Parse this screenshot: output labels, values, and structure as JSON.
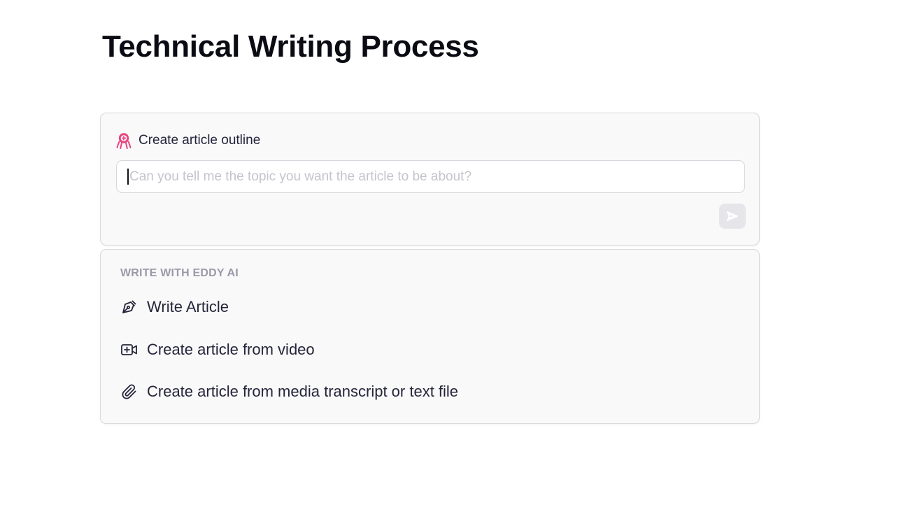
{
  "page": {
    "title": "Technical Writing Process"
  },
  "prompt": {
    "header_label": "Create article outline",
    "mascot_icon": "octopus-mascot-icon",
    "input_placeholder": "Can you tell me the topic you want the article to be about?",
    "input_value": "",
    "send_icon": "send-icon",
    "accent_color": "#e8457f"
  },
  "actions": {
    "heading": "WRITE WITH EDDY AI",
    "items": [
      {
        "label": "Write Article",
        "icon": "pen-nib-icon"
      },
      {
        "label": "Create article from video",
        "icon": "video-plus-icon"
      },
      {
        "label": "Create article from media transcript or text file",
        "icon": "paperclip-icon"
      }
    ]
  }
}
